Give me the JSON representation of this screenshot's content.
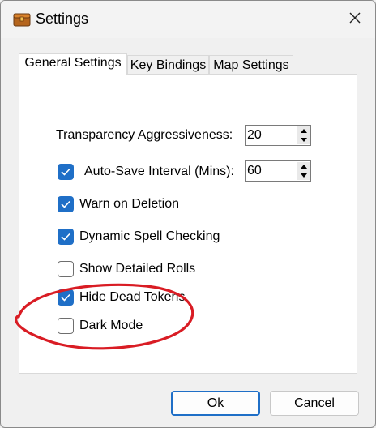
{
  "window": {
    "title": "Settings",
    "app_icon": "treasure-chest-icon",
    "close_icon": "close-icon"
  },
  "tabs": [
    {
      "label": "General Settings",
      "active": true
    },
    {
      "label": "Key Bindings",
      "active": false
    },
    {
      "label": "Map Settings",
      "active": false
    }
  ],
  "settings": {
    "transparency": {
      "label": "Transparency Aggressiveness:",
      "value": "20"
    },
    "autosave": {
      "label": "Auto-Save Interval (Mins):",
      "value": "60",
      "checked": true
    },
    "warn_deletion": {
      "label": "Warn on Deletion",
      "checked": true
    },
    "spell_check": {
      "label": "Dynamic Spell Checking",
      "checked": true
    },
    "detailed_rolls": {
      "label": "Show Detailed Rolls",
      "checked": false
    },
    "hide_dead": {
      "label": "Hide Dead Tokens",
      "checked": true
    },
    "dark_mode": {
      "label": "Dark Mode",
      "checked": false
    }
  },
  "buttons": {
    "ok": "Ok",
    "cancel": "Cancel"
  },
  "colors": {
    "accent": "#1f6fc7",
    "annotation": "#d91c24"
  }
}
